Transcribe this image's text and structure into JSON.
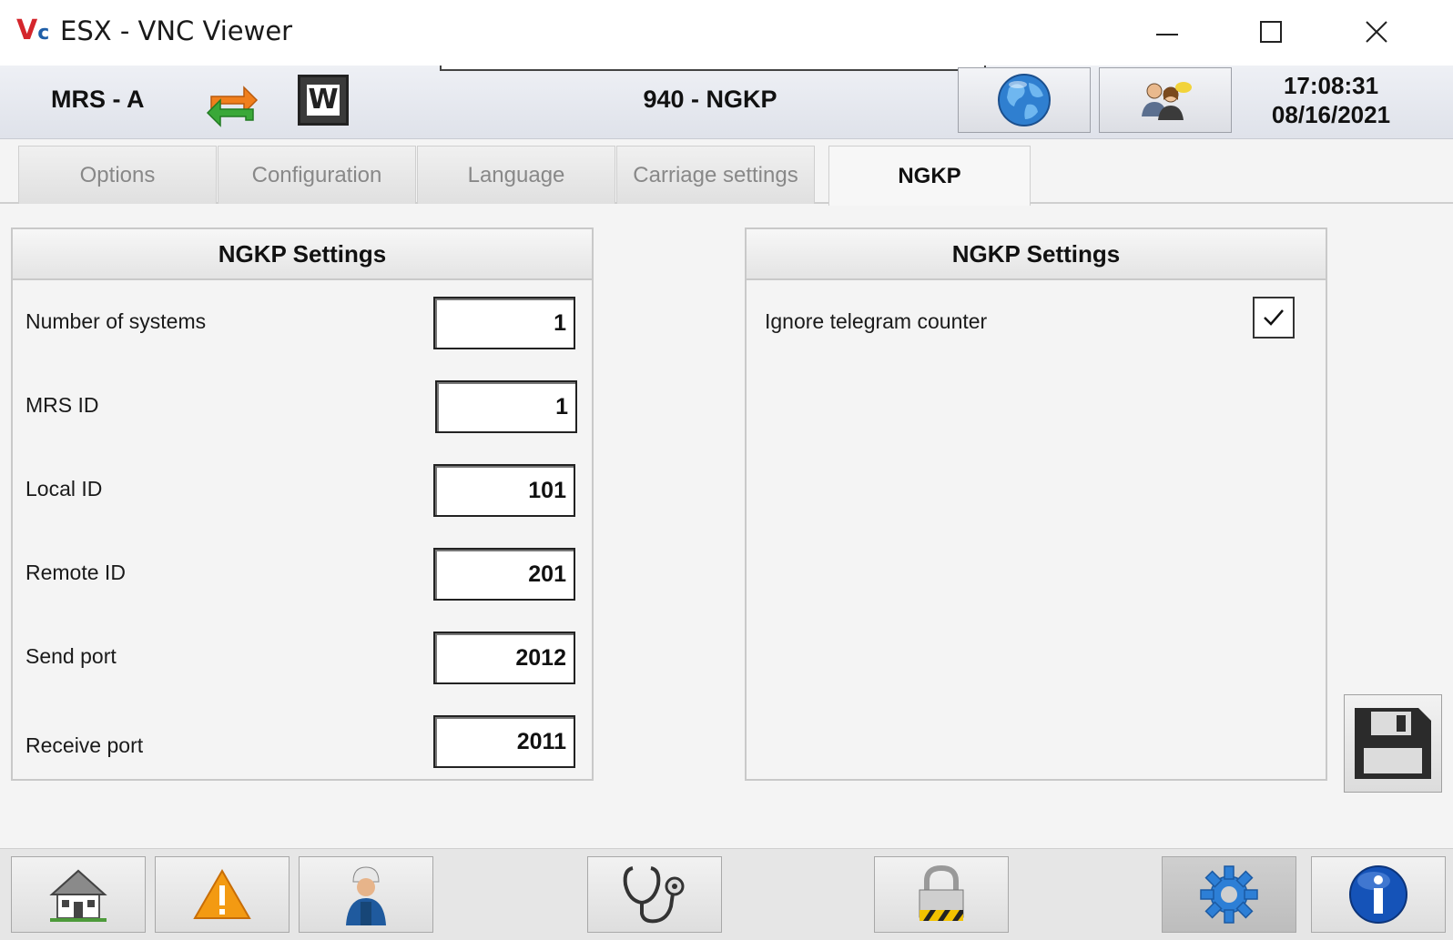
{
  "window": {
    "logo_letters": "V",
    "logo_sub": "c",
    "title": "ESX - VNC Viewer"
  },
  "header": {
    "mrs": "MRS - A",
    "center_title": "940 - NGKP",
    "time": "17:08:31",
    "date": "08/16/2021",
    "icons": [
      "sync-icon",
      "w-icon",
      "globe-icon",
      "users-icon"
    ]
  },
  "tabs": [
    {
      "label": "Options",
      "active": false
    },
    {
      "label": "Configuration",
      "active": false
    },
    {
      "label": "Language",
      "active": false
    },
    {
      "label": "Carriage settings",
      "active": false
    },
    {
      "label": "NGKP",
      "active": true
    }
  ],
  "left_panel": {
    "title": "NGKP Settings",
    "rows": [
      {
        "label": "Number of systems",
        "value": "1"
      },
      {
        "label": "MRS ID",
        "value": "1"
      },
      {
        "label": "Local ID",
        "value": "101"
      },
      {
        "label": "Remote ID",
        "value": "201"
      },
      {
        "label": "Send port",
        "value": "2012"
      },
      {
        "label": "Receive port",
        "value": "2011"
      }
    ]
  },
  "right_panel": {
    "title": "NGKP Settings",
    "option_label": "Ignore telegram counter",
    "option_checked": true
  },
  "footer": {
    "buttons": [
      "home-icon",
      "warning-icon",
      "technician-icon",
      "stethoscope-icon",
      "lock-icon",
      "settings-gear-icon",
      "info-icon"
    ],
    "active": "settings-gear-icon"
  },
  "colors": {
    "warning": "#f39a12",
    "info": "#1553b8",
    "gear": "#2d7fd6",
    "sync_orange": "#f07f1c",
    "sync_green": "#3aa838"
  }
}
